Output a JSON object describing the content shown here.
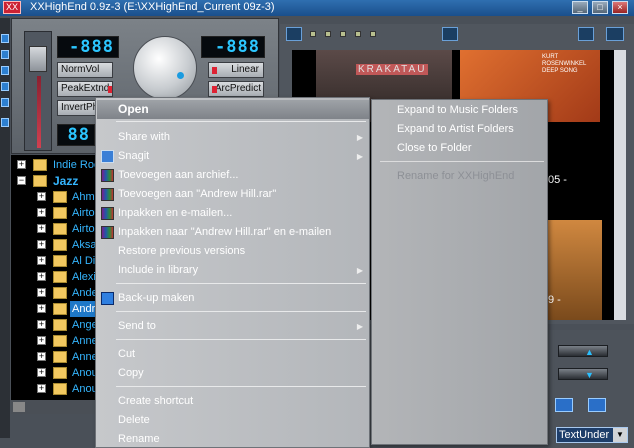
{
  "window": {
    "title": "XXHighEnd 0.9z-3 (E:\\XXHighEnd_Current 09z-3)",
    "app_badge": "XX"
  },
  "player": {
    "lcd_left": "-888",
    "lcd_right": "-888",
    "lcd_lower": "88",
    "buttons": {
      "normvol": "NormVol",
      "peakextnd": "PeakExtnd",
      "invertph": "InvertPh",
      "linear": "Linear",
      "arcpredict": "ArcPredict"
    }
  },
  "tree": {
    "items": [
      {
        "label": "Indie Rock",
        "level": 0,
        "expander": "+",
        "selected": false,
        "bold": false
      },
      {
        "label": "Jazz",
        "level": 0,
        "expander": "−",
        "selected": false,
        "bold": true
      },
      {
        "label": "Ahmad Jamal",
        "level": 1,
        "expander": "+",
        "selected": false,
        "bold": false
      },
      {
        "label": "Airto Moreira",
        "level": 1,
        "expander": "+",
        "selected": false,
        "bold": false
      },
      {
        "label": "Airto & Flora",
        "level": 1,
        "expander": "+",
        "selected": false,
        "bold": false
      },
      {
        "label": "Aksak Maboul",
        "level": 1,
        "expander": "+",
        "selected": false,
        "bold": false
      },
      {
        "label": "Al Di Meola",
        "level": 1,
        "expander": "+",
        "selected": false,
        "bold": false
      },
      {
        "label": "Alexis Cuadrado",
        "level": 1,
        "expander": "+",
        "selected": false,
        "bold": false
      },
      {
        "label": "Anders Jormin",
        "level": 1,
        "expander": "+",
        "selected": false,
        "bold": false
      },
      {
        "label": "Andrew Hill",
        "level": 1,
        "expander": "+",
        "selected": true,
        "bold": false
      },
      {
        "label": "Angela Hewitt",
        "level": 1,
        "expander": "+",
        "selected": false,
        "bold": false
      },
      {
        "label": "Anne Sofie",
        "level": 1,
        "expander": "+",
        "selected": false,
        "bold": false
      },
      {
        "label": "Annette Peacock",
        "level": 1,
        "expander": "+",
        "selected": false,
        "bold": false
      },
      {
        "label": "Anouar Brahem",
        "level": 1,
        "expander": "+",
        "selected": false,
        "bold": false
      },
      {
        "label": "Anouk",
        "level": 1,
        "expander": "+",
        "selected": false,
        "bold": false
      }
    ]
  },
  "albums": {
    "cover1_title": "KRAKATAU",
    "cover2_artist": "KURT ROSENWINKEL",
    "cover2_title": "DEEP SONG",
    "label_05": "05 -",
    "label_09": "9 -"
  },
  "view_selector": {
    "value": "TextUnder",
    "dropdown_icon": "triangle-down"
  },
  "context_menu": {
    "items": [
      {
        "label": "Open",
        "type": "header"
      },
      {
        "type": "separator"
      },
      {
        "label": "Share with",
        "submenu": true
      },
      {
        "label": "Snagit",
        "submenu": true,
        "icon": "snagit-icon"
      },
      {
        "label": "Toevoegen aan archief...",
        "icon": "winrar-icon"
      },
      {
        "label": "Toevoegen aan \"Andrew Hill.rar\"",
        "icon": "winrar-icon"
      },
      {
        "label": "Inpakken en e-mailen...",
        "icon": "winrar-icon"
      },
      {
        "label": "Inpakken naar \"Andrew Hill.rar\" en e-mailen",
        "icon": "winrar-icon"
      },
      {
        "label": "Restore previous versions"
      },
      {
        "label": "Include in library",
        "submenu": true
      },
      {
        "type": "separator"
      },
      {
        "label": "Back-up maken",
        "icon": "backup-icon"
      },
      {
        "type": "separator"
      },
      {
        "label": "Send to",
        "submenu": true
      },
      {
        "type": "separator"
      },
      {
        "label": "Cut"
      },
      {
        "label": "Copy"
      },
      {
        "type": "separator"
      },
      {
        "label": "Create shortcut"
      },
      {
        "label": "Delete"
      },
      {
        "label": "Rename"
      }
    ]
  },
  "xx_submenu": {
    "items": [
      {
        "label": "Expand to Music Folders",
        "disabled": false
      },
      {
        "label": "Expand to Artist Folders",
        "disabled": false
      },
      {
        "label": "Close to Folder",
        "disabled": false
      },
      {
        "type": "separator"
      },
      {
        "label": "Rename for XXHighEnd",
        "disabled": true
      }
    ]
  }
}
